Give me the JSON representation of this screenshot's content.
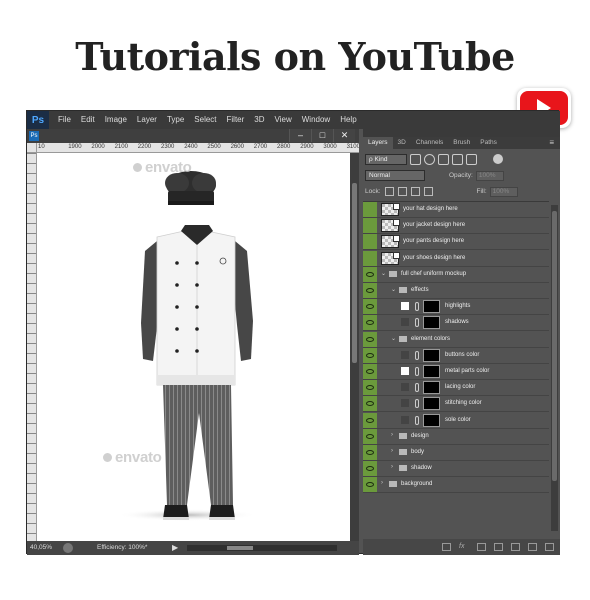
{
  "headline": "Tutorials on YouTube",
  "youtube_badge": {
    "icon": "youtube-play-icon",
    "color": "#e8151b"
  },
  "menubar": {
    "logo": "Ps",
    "items": [
      "File",
      "Edit",
      "Image",
      "Layer",
      "Type",
      "Select",
      "Filter",
      "3D",
      "View",
      "Window",
      "Help"
    ]
  },
  "document": {
    "tab_icon": "Ps",
    "window_buttons": [
      "–",
      "□",
      "✕"
    ],
    "ruler_labels": [
      "10",
      "1900",
      "2000",
      "2100",
      "2200",
      "2300",
      "2400",
      "2500",
      "2600",
      "2700",
      "2800",
      "2900",
      "3000",
      "3100"
    ],
    "watermark": "envato",
    "zoom": "40,05%",
    "efficiency": "Efficiency: 100%*"
  },
  "layers_panel": {
    "tabs": [
      "Layers",
      "3D",
      "Channels",
      "Brush",
      "Paths"
    ],
    "kind_label": "ρ Kind",
    "blend_mode": "Normal",
    "opacity_label": "Opacity:",
    "opacity_value": "100%",
    "lock_label": "Lock:",
    "fill_label": "Fill:",
    "fill_value": "100%",
    "layers": [
      {
        "name": "your hat design here",
        "type": "smart",
        "indent": 0,
        "visible": false
      },
      {
        "name": "your jacket design here",
        "type": "smart",
        "indent": 0,
        "visible": false
      },
      {
        "name": "your pants design here",
        "type": "smart",
        "indent": 0,
        "visible": false
      },
      {
        "name": "your shoes design here",
        "type": "smart",
        "indent": 0,
        "visible": false
      },
      {
        "name": "full chef uniform mockup",
        "type": "group-open",
        "indent": 0,
        "visible": true
      },
      {
        "name": "effects",
        "type": "group-open",
        "indent": 1,
        "visible": true
      },
      {
        "name": "highlights",
        "type": "masked-white",
        "indent": 2,
        "visible": true
      },
      {
        "name": "shadows",
        "type": "masked-dark",
        "indent": 2,
        "visible": true
      },
      {
        "name": "element colors",
        "type": "group-open",
        "indent": 1,
        "visible": true
      },
      {
        "name": "buttons color",
        "type": "masked-dark",
        "indent": 2,
        "visible": true
      },
      {
        "name": "metal parts color",
        "type": "masked-white",
        "indent": 2,
        "visible": true
      },
      {
        "name": "lacing color",
        "type": "masked-dark",
        "indent": 2,
        "visible": true
      },
      {
        "name": "stitching color",
        "type": "masked-dark",
        "indent": 2,
        "visible": true
      },
      {
        "name": "sole color",
        "type": "masked-dark",
        "indent": 2,
        "visible": true
      },
      {
        "name": "design",
        "type": "group-closed",
        "indent": 1,
        "visible": true
      },
      {
        "name": "body",
        "type": "group-closed",
        "indent": 1,
        "visible": true
      },
      {
        "name": "shadow",
        "type": "group-closed",
        "indent": 1,
        "visible": true
      },
      {
        "name": "background",
        "type": "group-closed",
        "indent": 0,
        "visible": true
      }
    ],
    "footer_icons": [
      "link-icon",
      "fx-icon",
      "mask-icon",
      "adjustment-icon",
      "folder-icon",
      "new-layer-icon",
      "trash-icon"
    ]
  }
}
